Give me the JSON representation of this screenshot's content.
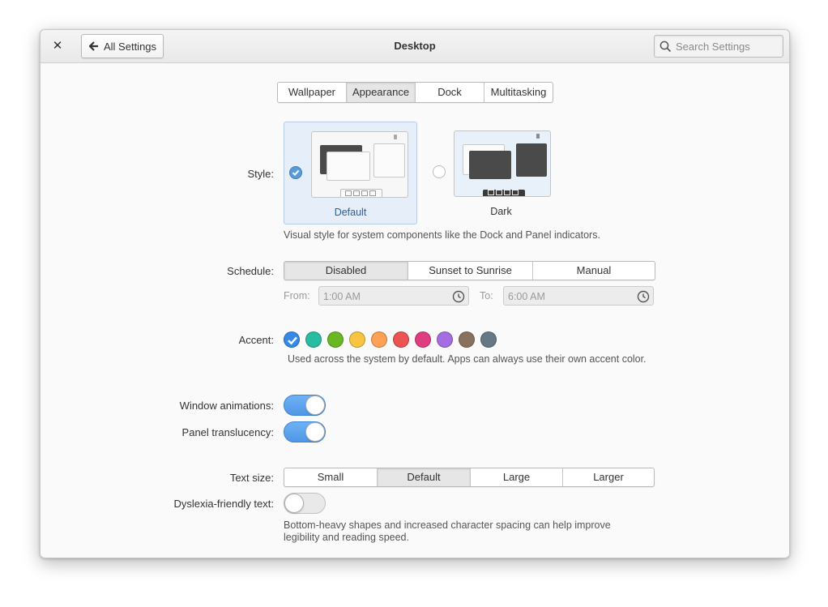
{
  "header": {
    "close_glyph": "✕",
    "back_label": "All Settings",
    "title": "Desktop",
    "search_placeholder": "Search Settings"
  },
  "tabs": [
    {
      "label": "Wallpaper",
      "active": false
    },
    {
      "label": "Appearance",
      "active": true
    },
    {
      "label": "Dock",
      "active": false
    },
    {
      "label": "Multitasking",
      "active": false
    }
  ],
  "style": {
    "label": "Style:",
    "options": [
      {
        "label": "Default",
        "selected": true
      },
      {
        "label": "Dark",
        "selected": false
      }
    ],
    "description": "Visual style for system components like the Dock and Panel indicators."
  },
  "schedule": {
    "label": "Schedule:",
    "options": [
      {
        "label": "Disabled",
        "active": true
      },
      {
        "label": "Sunset to Sunrise",
        "active": false
      },
      {
        "label": "Manual",
        "active": false
      }
    ],
    "from_label": "From:",
    "from_value": "1:00 AM",
    "to_label": "To:",
    "to_value": "6:00 AM"
  },
  "accent": {
    "label": "Accent:",
    "colors": [
      "#3689e6",
      "#28bca3",
      "#68b723",
      "#f9c440",
      "#ffa154",
      "#ed5353",
      "#de3e80",
      "#a56de2",
      "#8a715e",
      "#667885"
    ],
    "selected_index": 0,
    "description": "Used across the system by default. Apps can always use their own accent color."
  },
  "window_animations": {
    "label": "Window animations:",
    "on": true
  },
  "panel_translucency": {
    "label": "Panel translucency:",
    "on": true
  },
  "text_size": {
    "label": "Text size:",
    "options": [
      {
        "label": "Small",
        "active": false
      },
      {
        "label": "Default",
        "active": true
      },
      {
        "label": "Large",
        "active": false
      },
      {
        "label": "Larger",
        "active": false
      }
    ]
  },
  "dyslexia": {
    "label": "Dyslexia-friendly text:",
    "on": false,
    "description_line1": "Bottom-heavy shapes and increased character spacing can help improve",
    "description_line2": "legibility and reading speed."
  }
}
